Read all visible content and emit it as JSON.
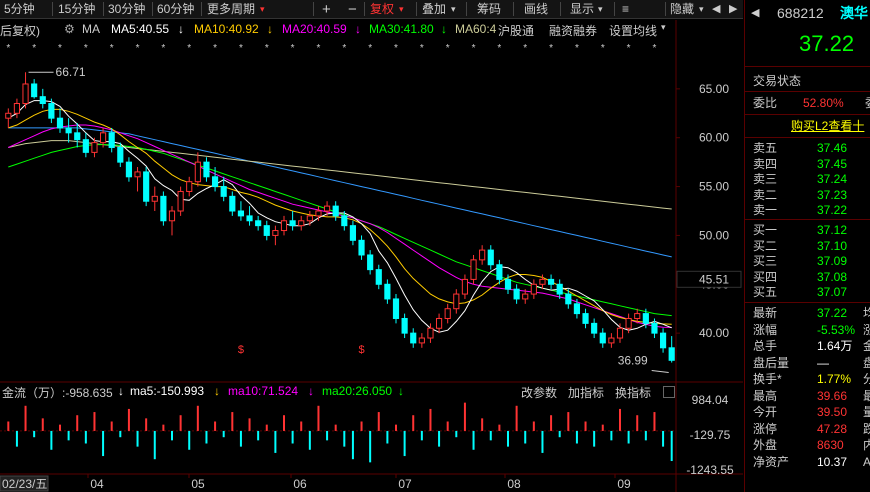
{
  "toolbar": {
    "periods": [
      "5分钟",
      "15分钟",
      "30分钟",
      "60分钟"
    ],
    "more_period": "更多周期",
    "plus": "+",
    "minus": "−",
    "fuquan": "复权",
    "diejia": "叠加",
    "chouma": "筹码",
    "huaxian": "画线",
    "xianshi": "显示",
    "yincang": "隐藏",
    "nav_left": "◀",
    "nav_right": "▶",
    "nav_more": "≡",
    "stock_code": "688212",
    "stock_name": "澳华"
  },
  "ma_line": {
    "prefix": "后复权)",
    "gear_icon": "gear-icon",
    "ma_label": "MA",
    "ma5": "MA5:40.55",
    "ma10": "MA10:40.92",
    "ma20": "MA20:40.59",
    "ma30": "MA30:41.80",
    "ma60": "MA60:4",
    "hugutong": "沪股通",
    "rongzi": "融资融券",
    "setting": "设置均线",
    "ma5_arrow": "↓",
    "ma10_arrow": "↓",
    "ma20_arrow": "↓",
    "ma30_arrow": "↓",
    "setting_arrow": "▾"
  },
  "colors": {
    "ma5": "#ffffff",
    "ma10": "#ffcc00",
    "ma20": "#ff00ff",
    "ma30": "#00ff00",
    "ma60": "#cccc99",
    "ma120": "#3399ff",
    "up": "#ff3333",
    "down": "#00ffff",
    "bg": "#000000"
  },
  "price_axis": {
    "labels": [
      "65.00",
      "60.00",
      "55.00",
      "50.00",
      "45.00",
      "40.00"
    ],
    "current": "45.51"
  },
  "markers": {
    "high": "66.71",
    "low": "36.99",
    "s_mark": "$"
  },
  "flow": {
    "label": "金流（万）:-958.635",
    "ma5": "ma5:-150.993",
    "ma10": "ma10:71.524",
    "ma20": "ma20:26.050",
    "arrow": "↓",
    "tabs": [
      "改参数",
      "加指标",
      "换指标"
    ],
    "axis": [
      "984.04",
      "-129.75",
      "-1243.55"
    ]
  },
  "dates": {
    "first": "02/23/五",
    "months": [
      "04",
      "05",
      "06",
      "07",
      "08",
      "09"
    ]
  },
  "chart_data": {
    "type": "candlestick",
    "ylim": [
      35,
      70
    ],
    "price_ticks": [
      65,
      60,
      55,
      50,
      45,
      40
    ],
    "candles": [
      [
        62,
        63,
        61,
        62.5
      ],
      [
        62.5,
        64,
        62,
        63.5
      ],
      [
        63.5,
        66.7,
        63,
        65.5
      ],
      [
        65.5,
        66,
        64,
        64.2
      ],
      [
        64.2,
        65,
        63,
        63.5
      ],
      [
        63.5,
        64,
        61.5,
        62
      ],
      [
        62,
        63,
        60.5,
        61
      ],
      [
        61,
        62,
        59.5,
        60.5
      ],
      [
        60.5,
        61.5,
        59,
        59.8
      ],
      [
        59.8,
        60.5,
        58,
        58.5
      ],
      [
        58.5,
        60,
        58,
        59.5
      ],
      [
        59.5,
        61,
        59,
        60.5
      ],
      [
        60.5,
        61,
        58.5,
        59
      ],
      [
        59,
        59.5,
        57,
        57.5
      ],
      [
        57.5,
        58,
        55.5,
        56
      ],
      [
        56,
        57,
        54.5,
        56.5
      ],
      [
        56.5,
        57,
        53,
        53.5
      ],
      [
        53.5,
        55,
        52.5,
        54
      ],
      [
        54,
        54.5,
        51,
        51.5
      ],
      [
        51.5,
        53,
        50,
        52.5
      ],
      [
        52.5,
        55,
        52,
        54.5
      ],
      [
        54.5,
        56,
        54,
        55.5
      ],
      [
        55.5,
        58.5,
        55,
        57.5
      ],
      [
        57.5,
        58,
        55.5,
        56
      ],
      [
        56,
        57,
        54.5,
        55
      ],
      [
        55,
        56,
        53.5,
        54
      ],
      [
        54,
        54.5,
        52,
        52.5
      ],
      [
        52.5,
        53.5,
        51.5,
        52
      ],
      [
        52,
        53,
        51,
        51.5
      ],
      [
        51.5,
        52,
        50.5,
        51
      ],
      [
        51,
        51.5,
        49.5,
        50
      ],
      [
        50,
        51,
        49,
        50.5
      ],
      [
        50.5,
        52,
        50,
        51.5
      ],
      [
        51.5,
        52.5,
        50.5,
        51
      ],
      [
        51,
        52,
        50.5,
        51.5
      ],
      [
        51.5,
        52.5,
        51,
        52
      ],
      [
        52,
        53,
        51.5,
        52.5
      ],
      [
        52.5,
        53.5,
        52,
        53
      ],
      [
        53,
        53.5,
        51.5,
        52
      ],
      [
        52,
        52.5,
        50.5,
        51
      ],
      [
        51,
        51.5,
        49,
        49.5
      ],
      [
        49.5,
        50,
        47.5,
        48
      ],
      [
        48,
        48.5,
        46,
        46.5
      ],
      [
        46.5,
        47,
        44.5,
        45
      ],
      [
        45,
        45.5,
        43,
        43.5
      ],
      [
        43.5,
        44,
        41,
        41.5
      ],
      [
        41.5,
        42,
        39.5,
        40
      ],
      [
        40,
        40.5,
        38.5,
        39
      ],
      [
        39,
        40,
        38.5,
        39.5
      ],
      [
        39.5,
        41,
        39,
        40.5
      ],
      [
        40.5,
        42,
        40,
        41.5
      ],
      [
        41.5,
        43,
        41,
        42.5
      ],
      [
        42.5,
        44.5,
        42,
        44
      ],
      [
        44,
        46,
        43.5,
        45.5
      ],
      [
        45.5,
        48,
        45,
        47.5
      ],
      [
        47.5,
        49,
        47,
        48.5
      ],
      [
        48.5,
        49,
        46.5,
        47
      ],
      [
        47,
        47.5,
        45,
        45.5
      ],
      [
        45.5,
        46,
        44,
        44.5
      ],
      [
        44.5,
        45,
        43,
        43.5
      ],
      [
        43.5,
        44.5,
        43,
        44
      ],
      [
        44,
        45.5,
        43.5,
        45
      ],
      [
        45,
        46,
        44.5,
        45.5
      ],
      [
        45.5,
        46,
        44.5,
        45
      ],
      [
        45,
        45.5,
        43.5,
        44
      ],
      [
        44,
        44.5,
        42.5,
        43
      ],
      [
        43,
        43.5,
        41.5,
        42
      ],
      [
        42,
        42.5,
        40.5,
        41
      ],
      [
        41,
        41.5,
        39.5,
        40
      ],
      [
        40,
        40.5,
        38.5,
        39
      ],
      [
        39,
        40,
        38.5,
        39.5
      ],
      [
        39.5,
        41,
        39,
        40.5
      ],
      [
        40.5,
        42,
        40,
        41.5
      ],
      [
        41.5,
        42.5,
        41,
        42
      ],
      [
        42,
        42.5,
        40.5,
        41
      ],
      [
        41,
        41.5,
        39.5,
        40
      ],
      [
        40,
        40.5,
        38,
        38.5
      ],
      [
        38.5,
        39.7,
        36.99,
        37.22
      ]
    ],
    "ma_series": {
      "ma5": [
        62,
        62.5,
        63.4,
        63.8,
        63.8,
        63.7,
        63.2,
        62.2,
        61.4,
        60.5,
        59.7,
        59.6,
        59.6,
        59.4,
        58.6,
        57.9,
        57.1,
        55.8,
        55.1,
        54.6,
        53.7,
        53.6,
        54.3,
        54.8,
        55.2,
        55.7,
        55.2,
        54.1,
        53.3,
        52.3,
        51.8,
        51.4,
        51.2,
        51,
        51,
        51.2,
        51.8,
        52.2,
        52.3,
        52.3,
        51.9,
        51.2,
        50.2,
        48.4,
        47.2,
        45.6,
        43.9,
        42.4,
        41.3,
        40.5,
        40.1,
        40.3,
        41.2,
        42.3,
        43.9,
        45.3,
        46.3,
        46.8,
        46.7,
        46.2,
        45.5,
        44.9,
        44.6,
        44.4,
        44.5,
        44.6,
        44.3,
        43.8,
        43.3,
        42.4,
        41.4,
        40.6,
        40.3,
        40.5,
        40.9,
        41.2,
        40.9,
        40.55
      ],
      "ma10": [
        61,
        61.3,
        61.8,
        62.3,
        62.7,
        62.9,
        62.9,
        62.7,
        62.4,
        62,
        61.6,
        61.3,
        60.9,
        60.3,
        59.6,
        59,
        58.4,
        57.6,
        56.9,
        56.2,
        55.7,
        55.4,
        55.2,
        55.1,
        55,
        55,
        54.7,
        54.4,
        54.2,
        53.9,
        53.5,
        53.1,
        52.8,
        52.5,
        52.3,
        52.1,
        52,
        51.9,
        51.9,
        51.8,
        51.6,
        51.2,
        50.6,
        49.8,
        48.9,
        47.8,
        46.6,
        45.6,
        44.8,
        44,
        43.5,
        43.2,
        43,
        43.1,
        43.4,
        43.9,
        44.6,
        45.2,
        45.7,
        46,
        46,
        45.9,
        45.7,
        45.3,
        44.8,
        44.3,
        43.8,
        43.3,
        42.8,
        42.3,
        41.9,
        41.6,
        41.4,
        41.2,
        41.1,
        41,
        40.95,
        40.92
      ],
      "ma20": [
        59,
        59.4,
        59.8,
        60.2,
        60.6,
        60.9,
        61.1,
        61.2,
        61.3,
        61.3,
        61.2,
        61,
        60.8,
        60.5,
        60.2,
        59.9,
        59.5,
        59.1,
        58.7,
        58.3,
        57.9,
        57.5,
        57.1,
        56.7,
        56.3,
        55.9,
        55.5,
        55.1,
        54.7,
        54.4,
        54.1,
        53.8,
        53.5,
        53.2,
        53,
        52.8,
        52.6,
        52.4,
        52.2,
        52,
        51.8,
        51.5,
        51.2,
        50.8,
        50.3,
        49.7,
        49.1,
        48.5,
        47.9,
        47.3,
        46.7,
        46.2,
        45.7,
        45.3,
        45,
        44.8,
        44.7,
        44.6,
        44.5,
        44.4,
        44.3,
        44.2,
        44.1,
        43.9,
        43.7,
        43.5,
        43.2,
        42.9,
        42.6,
        42.3,
        42,
        41.7,
        41.4,
        41.1,
        40.9,
        40.7,
        40.6,
        40.59
      ],
      "ma30": [
        57,
        57.3,
        57.6,
        57.9,
        58.2,
        58.5,
        58.7,
        58.9,
        59.1,
        59.2,
        59.3,
        59.3,
        59.3,
        59.2,
        59.1,
        59,
        58.8,
        58.6,
        58.4,
        58.1,
        57.8,
        57.5,
        57.2,
        56.9,
        56.6,
        56.3,
        56,
        55.7,
        55.4,
        55.1,
        54.8,
        54.5,
        54.2,
        53.9,
        53.6,
        53.3,
        53,
        52.7,
        52.4,
        52.1,
        51.8,
        51.5,
        51.2,
        50.9,
        50.5,
        50.1,
        49.7,
        49.3,
        48.9,
        48.5,
        48.1,
        47.7,
        47.3,
        47,
        46.7,
        46.4,
        46.1,
        45.8,
        45.5,
        45.2,
        45,
        44.8,
        44.6,
        44.4,
        44.2,
        44,
        43.8,
        43.6,
        43.4,
        43.2,
        43,
        42.8,
        42.6,
        42.4,
        42.2,
        42,
        41.9,
        41.8
      ],
      "ma60": [
        59,
        59.2,
        59.4,
        59.5,
        59.6,
        59.7,
        59.7,
        59.7,
        59.6,
        59.5,
        59.4,
        59.3,
        59.2,
        59.1,
        59,
        58.9,
        58.8,
        58.7,
        58.6,
        58.5,
        58.4,
        58.3,
        58.2,
        58.1,
        58,
        57.9,
        57.8,
        57.7,
        57.6,
        57.5,
        57.4,
        57.3,
        57.2,
        57.1,
        57,
        56.9,
        56.8,
        56.7,
        56.6,
        56.5,
        56.4,
        56.3,
        56.2,
        56.1,
        56,
        55.9,
        55.8,
        55.7,
        55.6,
        55.5,
        55.4,
        55.3,
        55.2,
        55.1,
        55,
        54.9,
        54.8,
        54.7,
        54.6,
        54.5,
        54.4,
        54.3,
        54.2,
        54.1,
        54,
        53.9,
        53.8,
        53.7,
        53.6,
        53.5,
        53.4,
        53.3,
        53.2,
        53.1,
        53,
        52.9,
        52.8,
        52.7
      ],
      "ma120": [
        61,
        61,
        61,
        61,
        61,
        61,
        61,
        61,
        61,
        60.9,
        60.8,
        60.7,
        60.6,
        60.5,
        60.4,
        60.2,
        60,
        59.8,
        59.6,
        59.4,
        59.2,
        59,
        58.8,
        58.6,
        58.4,
        58.2,
        58,
        57.8,
        57.6,
        57.4,
        57.2,
        57,
        56.8,
        56.6,
        56.4,
        56.2,
        56,
        55.8,
        55.6,
        55.4,
        55.2,
        55,
        54.8,
        54.6,
        54.4,
        54.2,
        54,
        53.8,
        53.6,
        53.4,
        53.2,
        53,
        52.8,
        52.6,
        52.4,
        52.2,
        52,
        51.8,
        51.6,
        51.4,
        51.2,
        51,
        50.8,
        50.6,
        50.4,
        50.2,
        50,
        49.8,
        49.6,
        49.4,
        49.2,
        49,
        48.8,
        48.6,
        48.4,
        48.2,
        48,
        47.8
      ]
    },
    "flow_values": [
      300,
      -500,
      800,
      -200,
      400,
      -600,
      200,
      -300,
      500,
      -400,
      600,
      -800,
      300,
      -200,
      700,
      -500,
      400,
      -900,
      200,
      -300,
      500,
      -600,
      800,
      -400,
      300,
      -200,
      600,
      -500,
      400,
      -300,
      200,
      -700,
      500,
      -400,
      300,
      -600,
      800,
      -300,
      200,
      -500,
      -900,
      300,
      -1000,
      600,
      -400,
      200,
      -800,
      500,
      -300,
      700,
      -500,
      300,
      -200,
      900,
      -600,
      400,
      -300,
      200,
      -500,
      800,
      -400,
      300,
      -700,
      500,
      -200,
      600,
      -400,
      300,
      -500,
      200,
      -300,
      700,
      -400,
      500,
      -300,
      600,
      -500,
      -958
    ]
  },
  "right_panel": {
    "title": "交易状态",
    "weibi_label": "委比",
    "weibi_value": "52.80%",
    "weibi_extra": "委",
    "buy_l2": "购买L2查看十",
    "sell": [
      {
        "label": "卖五",
        "price": "37.46"
      },
      {
        "label": "卖四",
        "price": "37.45"
      },
      {
        "label": "卖三",
        "price": "37.24"
      },
      {
        "label": "卖二",
        "price": "37.23"
      },
      {
        "label": "卖一",
        "price": "37.22"
      }
    ],
    "buy": [
      {
        "label": "买一",
        "price": "37.12"
      },
      {
        "label": "买二",
        "price": "37.10"
      },
      {
        "label": "买三",
        "price": "37.09"
      },
      {
        "label": "买四",
        "price": "37.08"
      },
      {
        "label": "买五",
        "price": "37.07"
      }
    ],
    "stats": [
      {
        "label": "最新",
        "value": "37.22",
        "extra": "均",
        "color": "#00ff00"
      },
      {
        "label": "涨幅",
        "value": "-5.53%",
        "extra": "涨",
        "color": "#00ff00"
      },
      {
        "label": "总手",
        "value": "1.64万",
        "extra": "金",
        "color": "#ffffff"
      },
      {
        "label": "盘后量",
        "value": "—",
        "extra": "盘",
        "color": "#ffffff"
      },
      {
        "label": "换手*",
        "value": "1.77%",
        "extra": "分",
        "color": "#ffff00"
      },
      {
        "label": "最高",
        "value": "39.66",
        "extra": "最",
        "color": "#ff3333"
      },
      {
        "label": "今开",
        "value": "39.50",
        "extra": "量",
        "color": "#ff3333"
      },
      {
        "label": "涨停",
        "value": "47.28",
        "extra": "跌",
        "color": "#ff3333"
      },
      {
        "label": "外盘",
        "value": "8630",
        "extra": "内",
        "color": "#ff3333"
      },
      {
        "label": "净资产",
        "value": "10.37",
        "extra": "A",
        "color": "#ffffff"
      }
    ],
    "price": "37.22"
  }
}
